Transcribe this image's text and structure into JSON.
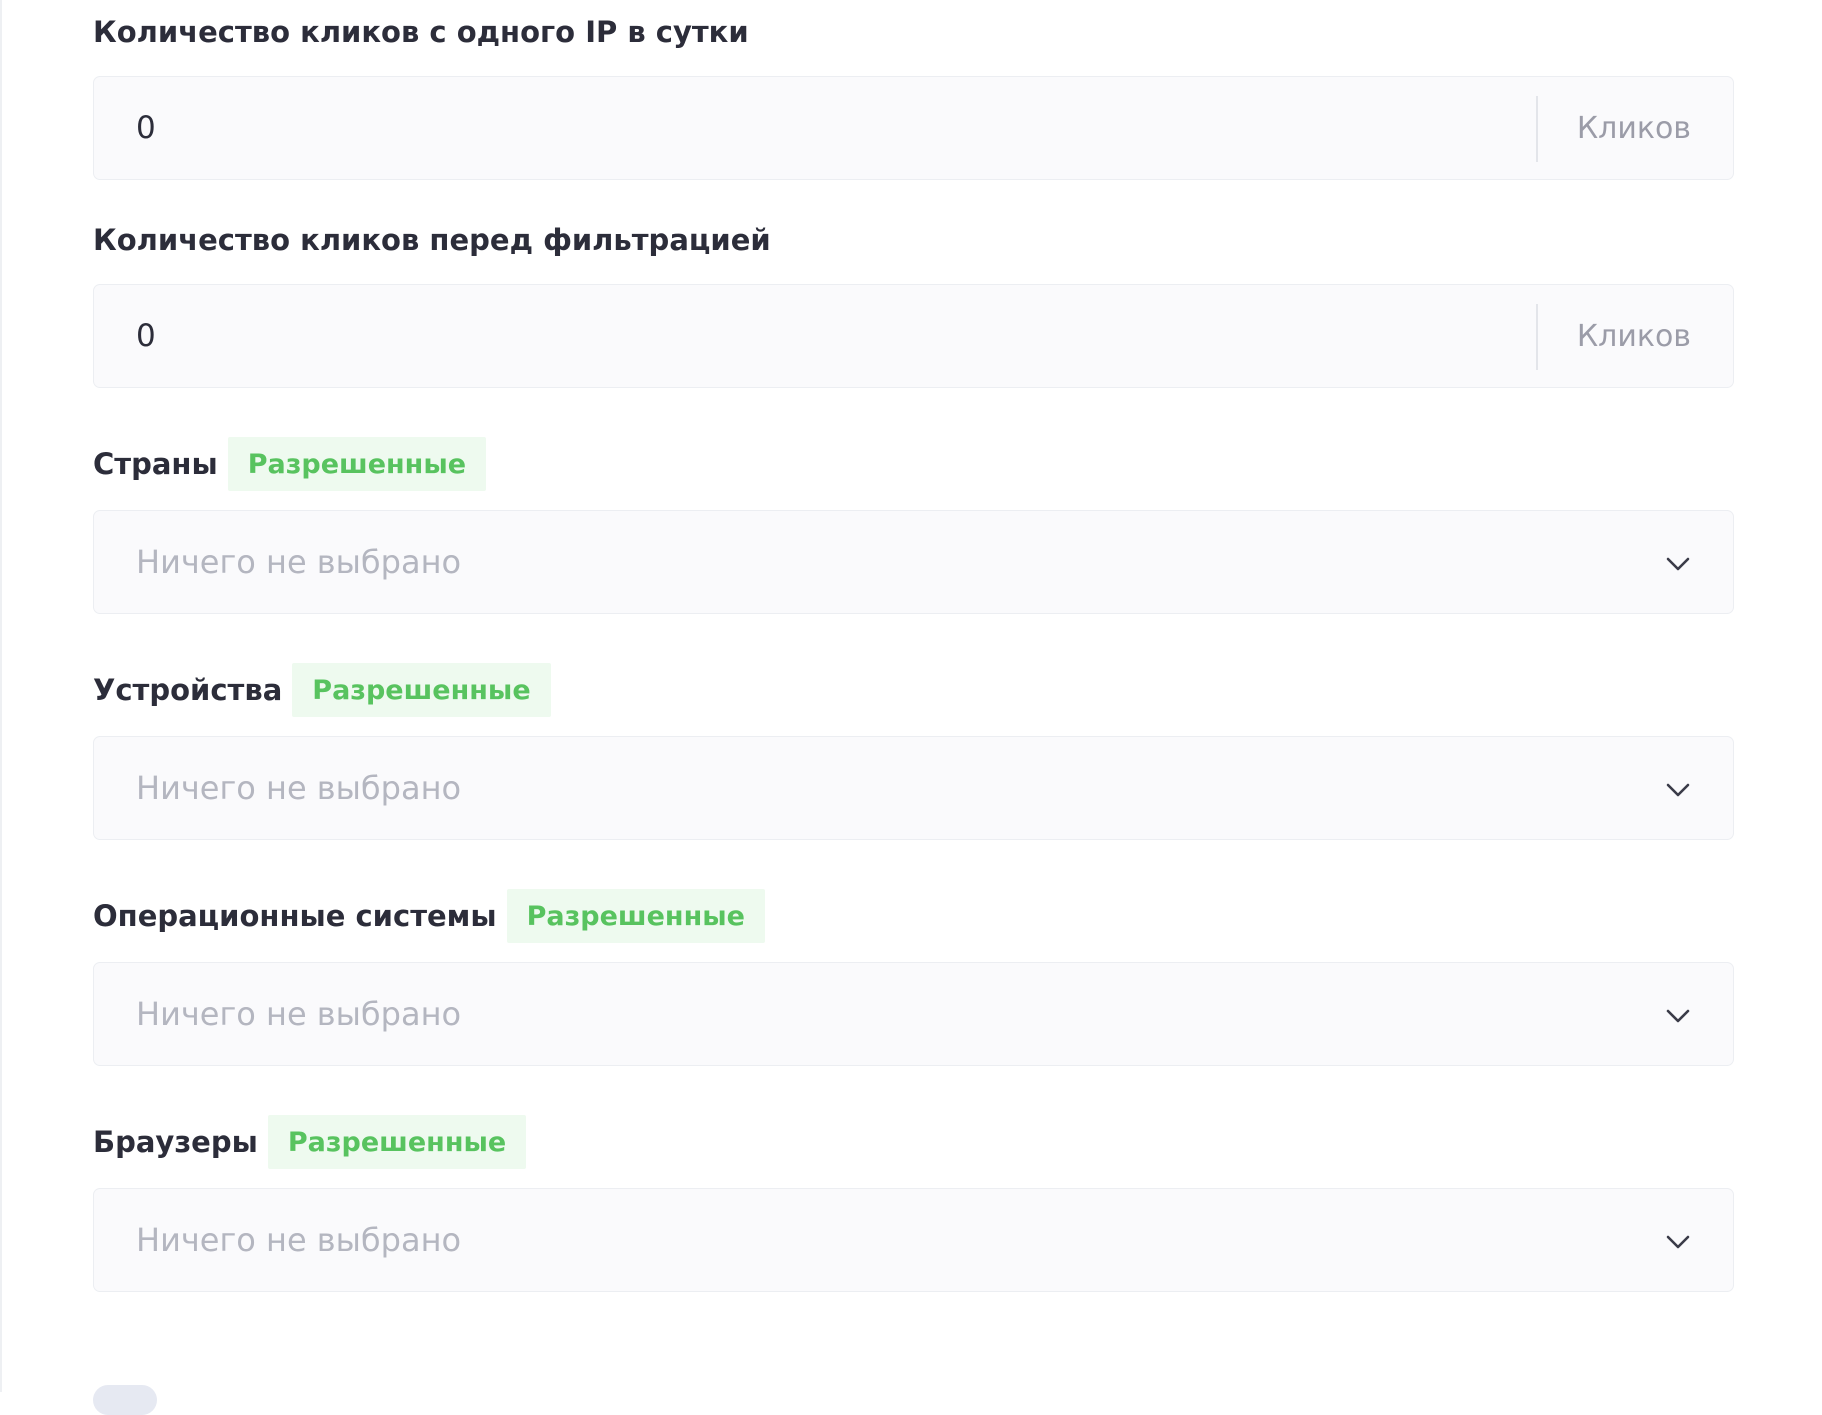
{
  "fields": {
    "clicks_per_ip": {
      "label": "Количество кликов с одного IP в сутки",
      "value": "0",
      "suffix": "Кликов"
    },
    "clicks_before_filter": {
      "label": "Количество кликов перед фильтрацией",
      "value": "0",
      "suffix": "Кликов"
    },
    "countries": {
      "label": "Страны",
      "badge": "Разрешенные",
      "placeholder": "Ничего не выбрано"
    },
    "devices": {
      "label": "Устройства",
      "badge": "Разрешенные",
      "placeholder": "Ничего не выбрано"
    },
    "os": {
      "label": "Операционные системы",
      "badge": "Разрешенные",
      "placeholder": "Ничего не выбрано"
    },
    "browsers": {
      "label": "Браузеры",
      "badge": "Разрешенные",
      "placeholder": "Ничего не выбрано"
    }
  },
  "icons": {
    "select_arrow": "chevron-down-icon"
  },
  "colors": {
    "badge_text": "#58c35f",
    "badge_bg": "#eefaef",
    "field_bg": "#fafafc",
    "label_text": "#2c2d3a",
    "placeholder_text": "#b4b6c0"
  }
}
